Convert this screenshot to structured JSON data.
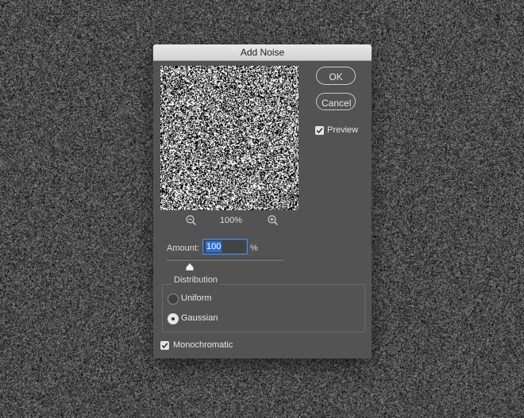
{
  "dialog": {
    "title": "Add Noise",
    "ok_label": "OK",
    "cancel_label": "Cancel",
    "preview": {
      "label": "Preview",
      "checked": true
    },
    "zoom": {
      "level": "100%",
      "zoom_out_icon": "zoom-out-icon",
      "zoom_in_icon": "zoom-in-icon"
    },
    "amount": {
      "label": "Amount:",
      "value": "100",
      "unit": "%",
      "slider_fraction": 0.2
    },
    "distribution": {
      "title": "Distribution",
      "options": [
        {
          "label": "Uniform",
          "selected": false
        },
        {
          "label": "Gaussian",
          "selected": true
        }
      ]
    },
    "monochromatic": {
      "label": "Monochromatic",
      "checked": true
    }
  },
  "colors": {
    "dialog_bg": "#535353",
    "accent": "#2e6fd6",
    "background": "#4a4a4a"
  }
}
